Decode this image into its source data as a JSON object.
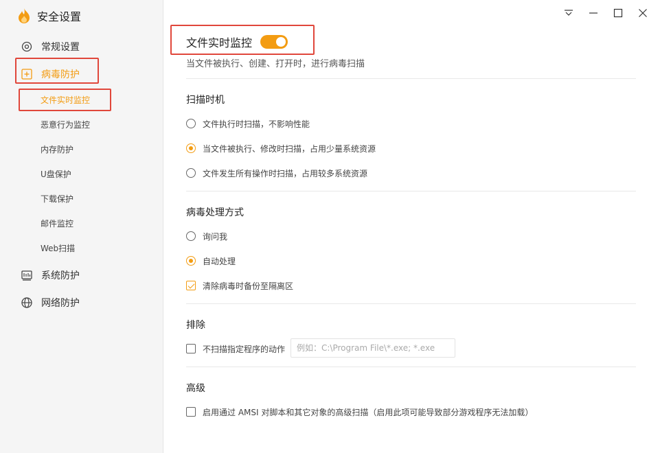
{
  "app": {
    "title": "安全设置"
  },
  "sidebar": {
    "items": [
      {
        "label": "常规设置",
        "icon": "gear-icon"
      },
      {
        "label": "病毒防护",
        "icon": "plus-square-icon",
        "active": true
      },
      {
        "label": "系统防护",
        "icon": "system-monitor-icon"
      },
      {
        "label": "网络防护",
        "icon": "globe-icon"
      }
    ],
    "subitems": [
      {
        "label": "文件实时监控",
        "active": true
      },
      {
        "label": "恶意行为监控"
      },
      {
        "label": "内存防护"
      },
      {
        "label": "U盘保护"
      },
      {
        "label": "下载保护"
      },
      {
        "label": "邮件监控"
      },
      {
        "label": "Web扫描"
      }
    ]
  },
  "window_controls": [
    "dropdown-icon",
    "minimize-icon",
    "maximize-icon",
    "close-icon"
  ],
  "main": {
    "header": {
      "title": "文件实时监控",
      "toggle_on": true,
      "description": "当文件被执行、创建、打开时，进行病毒扫描"
    },
    "scan_timing": {
      "title": "扫描时机",
      "options": [
        {
          "label": "文件执行时扫描，不影响性能",
          "selected": false
        },
        {
          "label": "当文件被执行、修改时扫描，占用少量系统资源",
          "selected": true
        },
        {
          "label": "文件发生所有操作时扫描，占用较多系统资源",
          "selected": false
        }
      ]
    },
    "handling": {
      "title": "病毒处理方式",
      "options": [
        {
          "label": "询问我",
          "selected": false
        },
        {
          "label": "自动处理",
          "selected": true
        }
      ],
      "backup": {
        "label": "清除病毒时备份至隔离区",
        "checked": true
      }
    },
    "exclude": {
      "title": "排除",
      "checkbox_label": "不扫描指定程序的动作",
      "checked": false,
      "placeholder": "例如：C:\\Program File\\*.exe; *.exe",
      "value": ""
    },
    "advanced": {
      "title": "高级",
      "checkbox_label": "启用通过 AMSI 对脚本和其它对象的高级扫描（启用此项可能导致部分游戏程序无法加载）",
      "checked": false
    }
  },
  "colors": {
    "accent": "#f39c12",
    "highlight": "#e0463a"
  }
}
